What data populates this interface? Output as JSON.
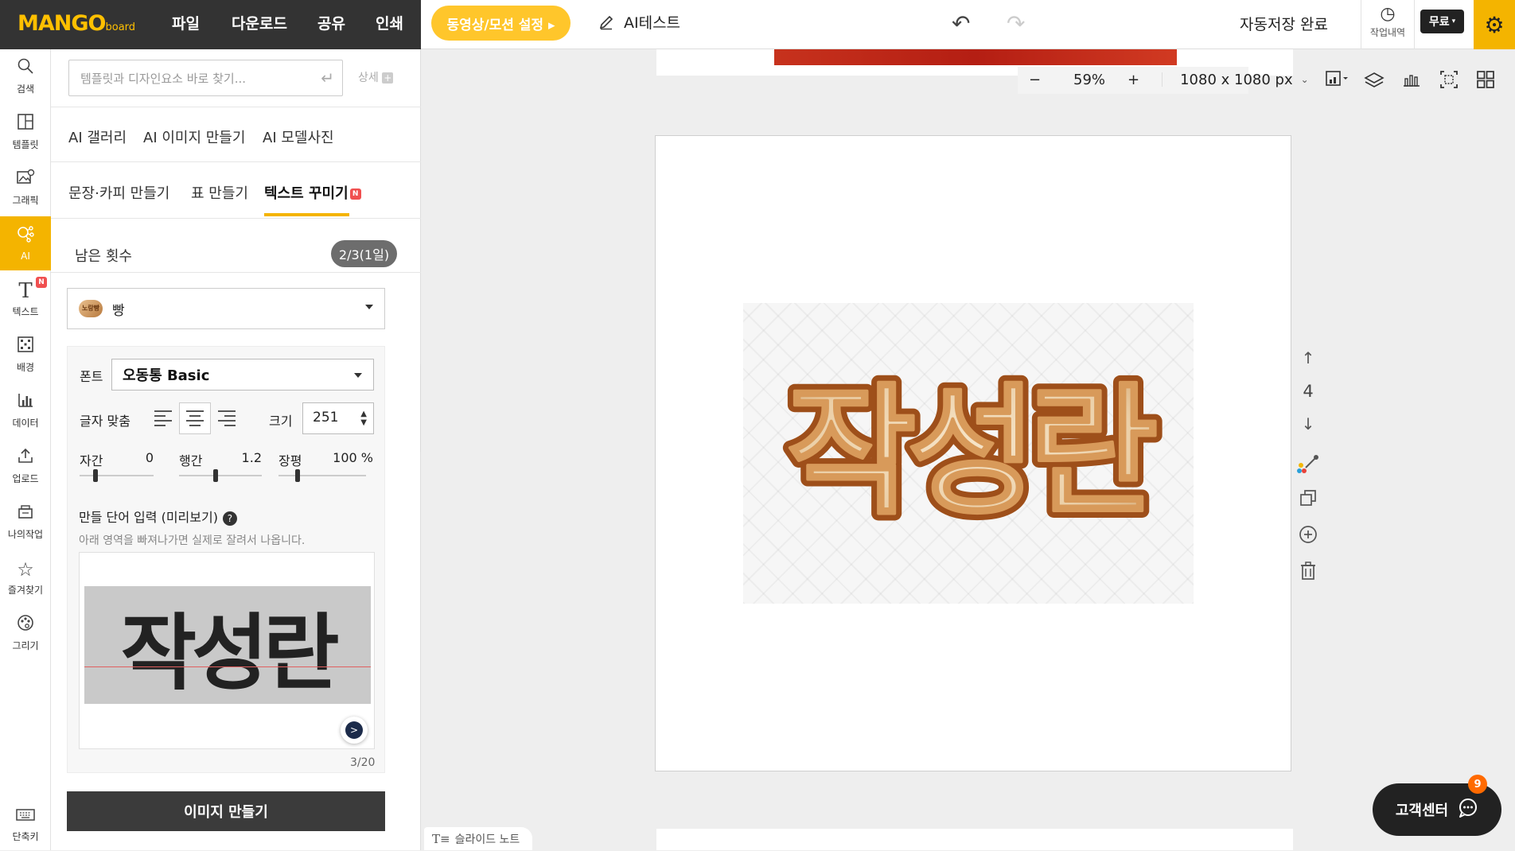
{
  "header": {
    "logo_text": "MANGO",
    "logo_suffix": "board",
    "menu": [
      "파일",
      "다운로드",
      "공유",
      "인쇄"
    ],
    "video_button": "동영상/모션 설정 ▸",
    "doc_title": "AI테스트",
    "autosave": "자동저장 완료",
    "history_label": "작업내역",
    "plan_label": "무료"
  },
  "rail": [
    {
      "label": "검색",
      "icon": "search-icon"
    },
    {
      "label": "템플릿",
      "icon": "template-icon"
    },
    {
      "label": "그래픽",
      "icon": "graphic-icon"
    },
    {
      "label": "AI",
      "icon": "ai-icon"
    },
    {
      "label": "텍스트",
      "icon": "text-icon"
    },
    {
      "label": "배경",
      "icon": "background-icon"
    },
    {
      "label": "데이터",
      "icon": "chart-icon"
    },
    {
      "label": "업로드",
      "icon": "upload-icon"
    },
    {
      "label": "나의작업",
      "icon": "folder-icon"
    },
    {
      "label": "즐겨찾기",
      "icon": "star-icon"
    },
    {
      "label": "그리기",
      "icon": "draw-icon"
    },
    {
      "label": "단축키",
      "icon": "keyboard-icon"
    }
  ],
  "panel": {
    "search_placeholder": "템플릿과 디자인요소 바로 찾기...",
    "detail_link": "상세",
    "ai_tabs": [
      "AI 갤러리",
      "AI 이미지 만들기",
      "AI 모델사진"
    ],
    "ai_subtabs": [
      "문장·카피 만들기",
      "표 만들기",
      "텍스트 꾸미기"
    ],
    "new_badge": "N",
    "remaining_label": "남은 횟수",
    "remaining_value": "2/3(1일)",
    "style_value": "빵",
    "style_thumb_text": "노랑빵",
    "font_label": "폰트",
    "font_value": "오동통 Basic",
    "align_label": "글자 맞춤",
    "size_label": "크기",
    "size_value": "251",
    "letter_spacing_label": "자간",
    "letter_spacing_value": "0",
    "line_spacing_label": "행간",
    "line_spacing_value": "1.2",
    "width_label": "장평",
    "width_value": "100 %",
    "word_input_label": "만들 단어 입력 (미리보기)",
    "word_hint": "아래 영역을 빠져나가면 실제로 잘려서 나옵니다.",
    "preview_word": "작성란",
    "char_count": "3/20",
    "make_button": "이미지 만들기"
  },
  "stage": {
    "zoom_minus": "−",
    "zoom_value": "59%",
    "zoom_plus": "+",
    "canvas_size": "1080 x 1080 px",
    "page_number": "4",
    "canvas_text": "작성란",
    "notes_tab": "슬라이드 노트",
    "support_button": "고객센터",
    "support_count": "9"
  },
  "colors": {
    "accent": "#f4b400",
    "video_button": "#ffc62b",
    "bread_crust": "#b5692c",
    "bread_crumb": "#f1dcc0"
  }
}
